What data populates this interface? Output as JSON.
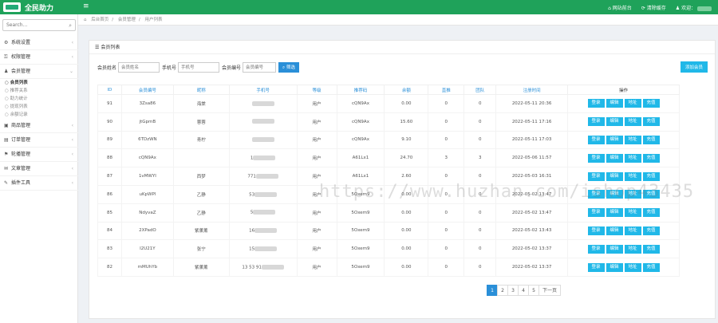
{
  "app": {
    "brand": "全民助力"
  },
  "topbar": {
    "site_home": "网站前台",
    "clear_cache": "清除缓存",
    "welcome": "欢迎："
  },
  "sidebar": {
    "search_placeholder": "Search...",
    "items": [
      {
        "label": "系统设置",
        "icon": "gear-icon"
      },
      {
        "label": "权限管理",
        "icon": "permission-icon"
      },
      {
        "label": "会员管理",
        "icon": "user-icon",
        "sub": [
          "会员列表",
          "推荐关系",
          "助力统计",
          "提现列表",
          "余额记录"
        ]
      },
      {
        "label": "商品管理",
        "icon": "goods-icon"
      },
      {
        "label": "订单管理",
        "icon": "order-icon"
      },
      {
        "label": "轮播管理",
        "icon": "flag-icon"
      },
      {
        "label": "文章管理",
        "icon": "chat-icon"
      },
      {
        "label": "插件工具",
        "icon": "plugin-icon"
      }
    ]
  },
  "breadcrumb": [
    "后台首页",
    "会员管理",
    "用户列表"
  ],
  "panel": {
    "title": "会员列表"
  },
  "filter": {
    "member_name_label": "会员姓名",
    "member_name_placeholder": "会员姓名",
    "phone_label": "手机号",
    "phone_placeholder": "手机号",
    "member_no_label": "会员编号",
    "member_no_placeholder": "会员编号",
    "search_btn": "筛选",
    "add_btn": "添加会员"
  },
  "table": {
    "headers": [
      "ID",
      "会员编号",
      "昵称",
      "手机号",
      "等级",
      "推荐码",
      "余额",
      "直推",
      "团队",
      "注册时间",
      "操作"
    ],
    "actions": [
      "登录",
      "编辑",
      "地址",
      "充值"
    ],
    "rows": [
      {
        "id": "91",
        "no": "3Zsa86",
        "nick": "海棠",
        "phone": "",
        "level": "用户",
        "code": "cQN9Ax",
        "balance": "0.00",
        "direct": "0",
        "team": "0",
        "time": "2022-05-11 20:36"
      },
      {
        "id": "90",
        "no": "jtGpmB",
        "nick": "蓉蓉",
        "phone": "",
        "level": "用户",
        "code": "cQN9Ax",
        "balance": "15.60",
        "direct": "0",
        "team": "0",
        "time": "2022-05-11 17:16"
      },
      {
        "id": "89",
        "no": "6TDzWN",
        "nick": "青柠",
        "phone": "",
        "level": "用户",
        "code": "cQN9Ax",
        "balance": "9.10",
        "direct": "0",
        "team": "0",
        "time": "2022-05-11 17:03"
      },
      {
        "id": "88",
        "no": "cQN9Ax",
        "nick": "",
        "phone": "1",
        "level": "用户",
        "code": "A61Lx1",
        "balance": "24.70",
        "direct": "3",
        "team": "3",
        "time": "2022-05-06 11:57"
      },
      {
        "id": "87",
        "no": "1vMWYI",
        "nick": "西梦",
        "phone": "771",
        "level": "用户",
        "code": "A61Lx1",
        "balance": "2.60",
        "direct": "0",
        "team": "0",
        "time": "2022-05-03 16:31"
      },
      {
        "id": "86",
        "no": "uKpWPl",
        "nick": "乙静",
        "phone": "53",
        "level": "用户",
        "code": "5Oxem9",
        "balance": "0.00",
        "direct": "0",
        "team": "0",
        "time": "2022-05-02 13:47"
      },
      {
        "id": "85",
        "no": "NdyvaZ",
        "nick": "乙静",
        "phone": "5",
        "level": "用户",
        "code": "5Oxem9",
        "balance": "0.00",
        "direct": "0",
        "team": "0",
        "time": "2022-05-02 13:47"
      },
      {
        "id": "84",
        "no": "2XPadO",
        "nick": "紫薰薰",
        "phone": "16",
        "level": "用户",
        "code": "5Oxem9",
        "balance": "0.00",
        "direct": "0",
        "team": "0",
        "time": "2022-05-02 13:43"
      },
      {
        "id": "83",
        "no": "I2U21Y",
        "nick": "张宁",
        "phone": "15",
        "level": "用户",
        "code": "5Oxem9",
        "balance": "0.00",
        "direct": "0",
        "team": "0",
        "time": "2022-05-02 13:37"
      },
      {
        "id": "82",
        "no": "mMUhYb",
        "nick": "紫薰薰",
        "phone": "13 53 91",
        "level": "用户",
        "code": "5Oxem9",
        "balance": "0.00",
        "direct": "0",
        "team": "0",
        "time": "2022-05-02 13:37"
      }
    ]
  },
  "pagination": {
    "pages": [
      "1",
      "2",
      "3",
      "4",
      "5"
    ],
    "next": "下一页",
    "current": "1"
  },
  "watermark": "https://www.huzhan.com/ishop43435",
  "colors": {
    "topbar": "#1fa25a",
    "primary": "#2a8fd8",
    "action": "#20b8e8"
  }
}
